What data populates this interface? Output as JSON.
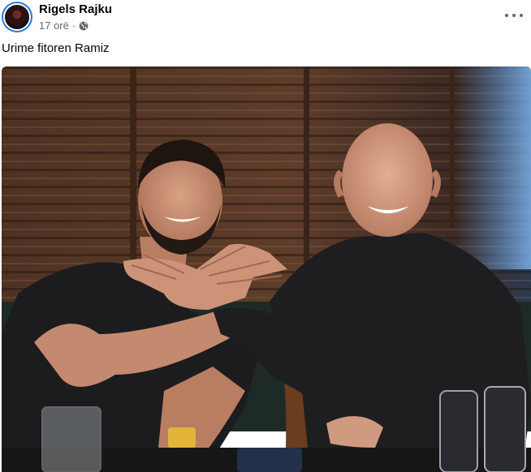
{
  "post": {
    "author": "Rigels Rajku",
    "time": "17 orë",
    "separator": "·",
    "privacy_icon": "globe-icon",
    "more_icon": "more-horizontal-icon",
    "caption": "Urime fitoren Ramiz"
  },
  "photo": {
    "kind": "photograph",
    "colors": {
      "blinds": "#5a3a28",
      "window_glow": "#5d8fc8",
      "shirt": "#1c1c1e",
      "skin": "#c98e74",
      "table": "#161616"
    }
  }
}
